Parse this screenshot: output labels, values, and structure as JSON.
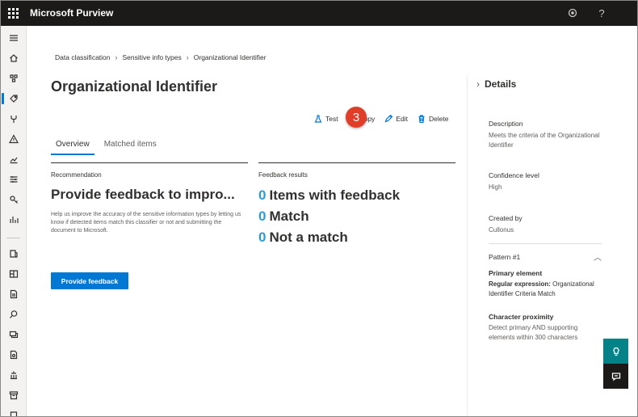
{
  "app": {
    "title": "Microsoft Purview"
  },
  "breadcrumb": [
    "Data classification",
    "Sensitive info types",
    "Organizational Identifier"
  ],
  "page": {
    "title": "Organizational Identifier"
  },
  "commands": {
    "test": "Test",
    "copy": "opy",
    "edit": "Edit",
    "delete": "Delete"
  },
  "step_badge": "3",
  "tabs": [
    {
      "label": "Overview",
      "active": true
    },
    {
      "label": "Matched items",
      "active": false
    }
  ],
  "recommendation": {
    "label": "Recommendation",
    "heading": "Provide feedback to impro...",
    "description": "Help us improve the accuracy of the sensitive information types by letting us know if detected items match this classifier or not and submitting the document to Microsoft.",
    "button": "Provide feedback"
  },
  "feedback": {
    "label": "Feedback results",
    "items": [
      {
        "count": "0",
        "text": "Items with feedback"
      },
      {
        "count": "0",
        "text": "Match"
      },
      {
        "count": "0",
        "text": "Not a match"
      }
    ]
  },
  "details": {
    "title": "Details",
    "description_label": "Description",
    "description_value": "Meets the criteria of the Organizational Identifier",
    "confidence_label": "Confidence level",
    "confidence_value": "High",
    "created_label": "Created by",
    "created_value": "Cullonus",
    "pattern_label": "Pattern #1",
    "primary_label": "Primary element",
    "primary_key": "Regular expression:",
    "primary_value": "Organizational Identifier Criteria Match",
    "proximity_label": "Character proximity",
    "proximity_value": "Detect primary AND supporting elements within 300 characters"
  },
  "colors": {
    "topbar": "#1b1a19",
    "accent": "#0078d4",
    "count": "#2b9bd8",
    "badge": "#e23d28",
    "help": "#038387"
  }
}
